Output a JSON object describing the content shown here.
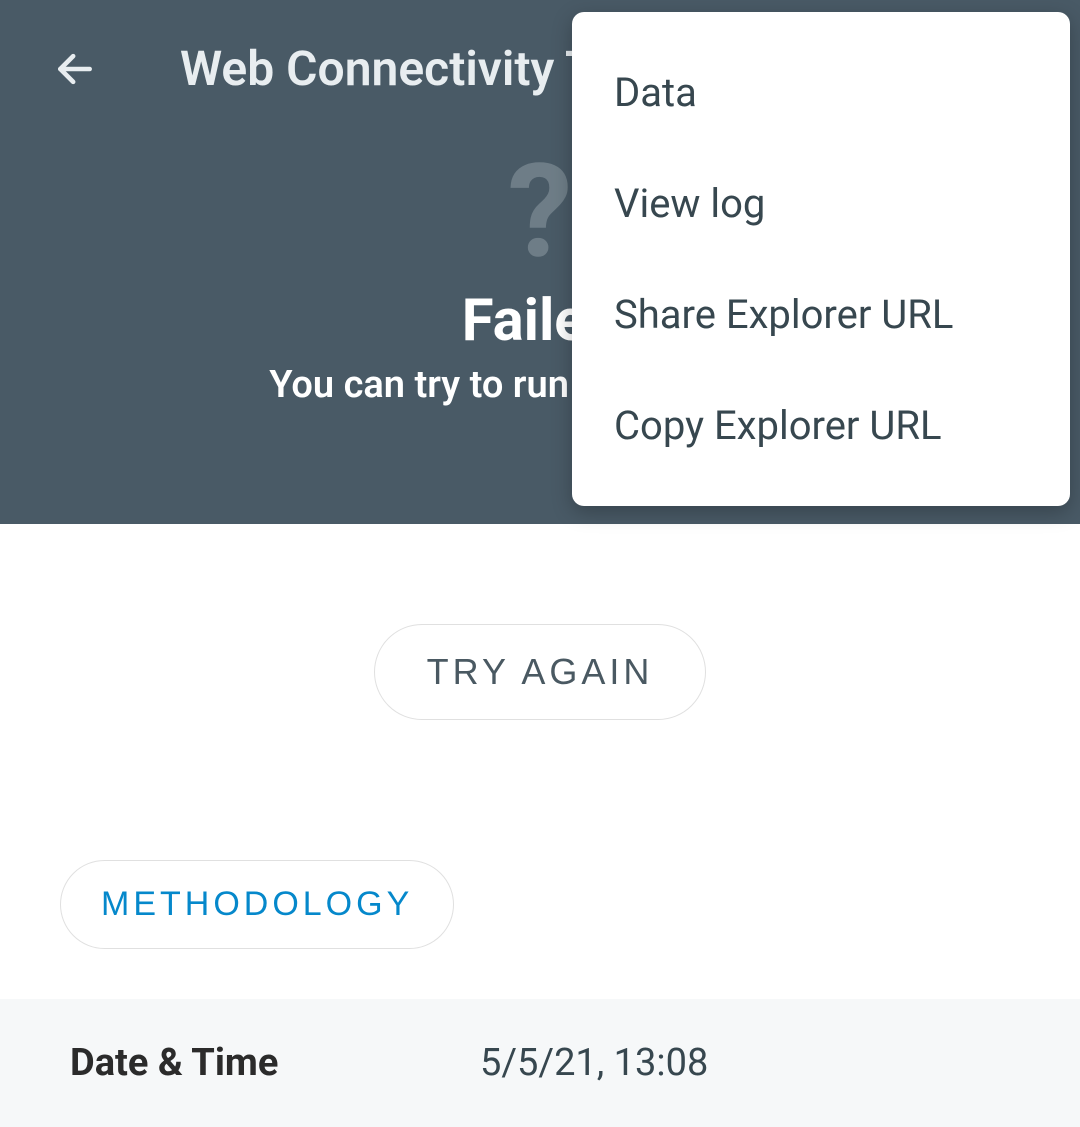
{
  "header": {
    "title": "Web Connectivity Test"
  },
  "result": {
    "title": "Failed",
    "subtitle": "You can try to run the test again"
  },
  "menu": {
    "items": [
      {
        "label": "Data"
      },
      {
        "label": "View log"
      },
      {
        "label": "Share Explorer URL"
      },
      {
        "label": "Copy Explorer URL"
      }
    ]
  },
  "buttons": {
    "try_again": "TRY AGAIN",
    "methodology": "METHODOLOGY"
  },
  "details": {
    "datetime_label": "Date & Time",
    "datetime_value": "5/5/21, 13:08"
  }
}
